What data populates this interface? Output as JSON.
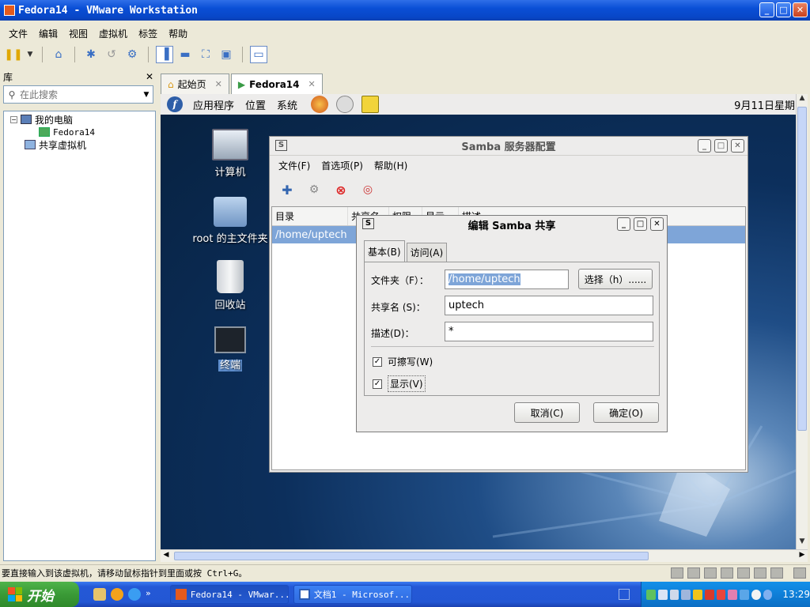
{
  "window": {
    "title": "Fedora14 - VMware Workstation",
    "min": "_",
    "max": "□",
    "close": "✕"
  },
  "menu": [
    "文件",
    "编辑",
    "视图",
    "虚拟机",
    "标签",
    "帮助"
  ],
  "library": {
    "title": "库",
    "close": "✕",
    "search_placeholder": "在此搜索",
    "tree": {
      "my_computer": "我的电脑",
      "vm": "Fedora14",
      "shared": "共享虚拟机"
    }
  },
  "tabs": [
    {
      "label": "起始页",
      "close": "✕"
    },
    {
      "label": "Fedora14",
      "close": "✕"
    }
  ],
  "gnome_panel": {
    "menus": [
      "应用程序",
      "位置",
      "系统"
    ],
    "clock": "9月11日星期"
  },
  "desktop_icons": [
    "计算机",
    "root 的主文件夹",
    "回收站",
    "终端"
  ],
  "samba": {
    "title": "Samba 服务器配置",
    "menu": [
      "文件(F)",
      "首选项(P)",
      "帮助(H)"
    ],
    "columns": [
      "目录",
      "共享名",
      "权限",
      "显示",
      "描述"
    ],
    "rows": [
      {
        "dir": "/home/uptech"
      }
    ]
  },
  "dialog": {
    "title": "编辑 Samba 共享",
    "tabs": [
      "基本(B)",
      "访问(A)"
    ],
    "folder_label": "文件夹（F）：",
    "folder_value": "/home/uptech",
    "browse_button": "选择（h）......",
    "share_label": "共享名 (S)：",
    "share_value": "uptech",
    "desc_label": "描述(D)：",
    "desc_value": "*",
    "writable": {
      "label": "可擦写(W)",
      "checked": true
    },
    "visible": {
      "label": "显示(V)",
      "checked": true
    },
    "cancel": "取消(C)",
    "ok": "确定(O)"
  },
  "status_text": "要直接输入到该虚拟机，请移动鼠标指针到里面或按 Ctrl+G。",
  "taskbar": {
    "start": "开始",
    "more": "»",
    "tasks": [
      "Fedora14 - VMwar...",
      "文档1 - Microsof..."
    ],
    "time": "13:29"
  }
}
